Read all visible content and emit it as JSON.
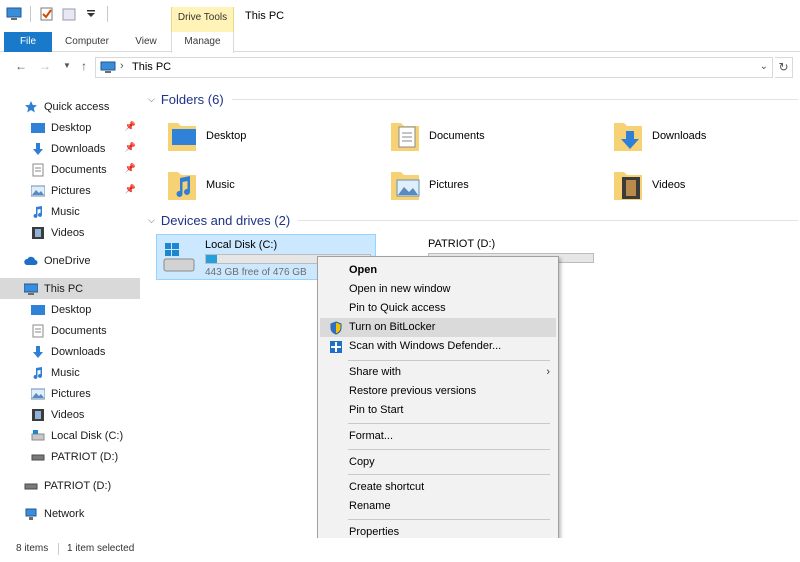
{
  "window": {
    "title": "This PC"
  },
  "quick_access_toolbar": {
    "icons": [
      "pc-icon",
      "properties-check-icon",
      "new-folder-icon",
      "customize-dropdown-icon"
    ]
  },
  "ribbon": {
    "context_tab_group": "Drive Tools",
    "tabs": [
      {
        "label": "File",
        "active": true
      },
      {
        "label": "Computer"
      },
      {
        "label": "View"
      },
      {
        "label": "Manage"
      }
    ]
  },
  "address_bar": {
    "path": [
      "This PC"
    ],
    "back_icon": "arrow-left-icon",
    "forward_icon": "arrow-right-icon",
    "up_icon": "arrow-up-icon",
    "refresh_icon": "refresh-icon"
  },
  "nav_pane": {
    "quick_access": {
      "label": "Quick access",
      "items": [
        {
          "label": "Desktop",
          "pinned": true
        },
        {
          "label": "Downloads",
          "pinned": true
        },
        {
          "label": "Documents",
          "pinned": true
        },
        {
          "label": "Pictures",
          "pinned": true
        },
        {
          "label": "Music"
        },
        {
          "label": "Videos"
        }
      ]
    },
    "onedrive": {
      "label": "OneDrive"
    },
    "this_pc": {
      "label": "This PC",
      "items": [
        {
          "label": "Desktop"
        },
        {
          "label": "Documents"
        },
        {
          "label": "Downloads"
        },
        {
          "label": "Music"
        },
        {
          "label": "Pictures"
        },
        {
          "label": "Videos"
        },
        {
          "label": "Local Disk (C:)"
        },
        {
          "label": "PATRIOT (D:)"
        }
      ]
    },
    "patriot": {
      "label": "PATRIOT (D:)"
    },
    "network": {
      "label": "Network"
    }
  },
  "main": {
    "folders_header": "Folders (6)",
    "folders": [
      {
        "label": "Desktop"
      },
      {
        "label": "Documents"
      },
      {
        "label": "Downloads"
      },
      {
        "label": "Music"
      },
      {
        "label": "Pictures"
      },
      {
        "label": "Videos"
      }
    ],
    "drives_header": "Devices and drives (2)",
    "drives": [
      {
        "label": "Local Disk (C:)",
        "free": "443 GB free of 476 GB",
        "used_fraction": 0.07
      },
      {
        "label": "PATRIOT (D:)",
        "free": "",
        "used_fraction": 0.0
      }
    ]
  },
  "context_menu": {
    "items": [
      {
        "label": "Open",
        "bold": true
      },
      {
        "label": "Open in new window"
      },
      {
        "label": "Pin to Quick access"
      },
      {
        "label": "Turn on BitLocker",
        "icon": "shield-icon",
        "highlighted": true
      },
      {
        "label": "Scan with Windows Defender...",
        "icon": "defender-icon"
      },
      {
        "label": "Share with",
        "submenu": true
      },
      {
        "label": "Restore previous versions"
      },
      {
        "label": "Pin to Start"
      },
      {
        "label": "Format..."
      },
      {
        "label": "Copy"
      },
      {
        "label": "Create shortcut"
      },
      {
        "label": "Rename"
      },
      {
        "label": "Properties"
      }
    ]
  },
  "status_bar": {
    "items_count": "8 items",
    "selection": "1 item selected"
  },
  "colors": {
    "accent": "#1979ca",
    "selection": "#cce8ff",
    "header_text": "#1e3287",
    "context_tab": "#fff3b8"
  }
}
